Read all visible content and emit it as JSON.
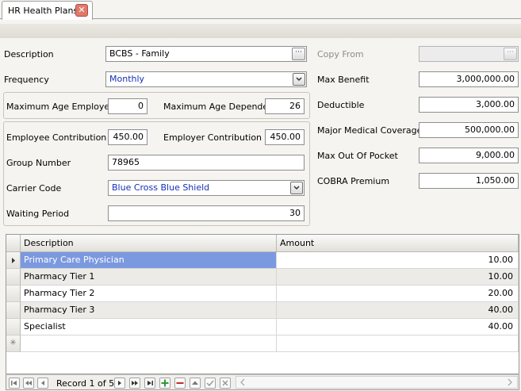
{
  "tab": {
    "label": "HR Health Plans",
    "close_glyph": "✕"
  },
  "form": {
    "description": {
      "label": "Description",
      "value": "BCBS - Family"
    },
    "frequency": {
      "label": "Frequency",
      "value": "Monthly"
    },
    "copy_from": {
      "label": "Copy From",
      "value": ""
    },
    "max_age_employee": {
      "label": "Maximum Age Employee",
      "value": "0"
    },
    "max_age_dependent": {
      "label": "Maximum Age Dependent",
      "value": "26"
    },
    "employee_contribution": {
      "label": "Employee Contribution",
      "value": "450.00"
    },
    "employer_contribution": {
      "label": "Employer Contribution",
      "value": "450.00"
    },
    "group_number": {
      "label": "Group Number",
      "value": "78965"
    },
    "carrier_code": {
      "label": "Carrier Code",
      "value": "Blue Cross Blue Shield"
    },
    "waiting_period": {
      "label": "Waiting Period",
      "value": "30"
    },
    "max_benefit": {
      "label": "Max Benefit",
      "value": "3,000,000.00"
    },
    "deductible": {
      "label": "Deductible",
      "value": "3,000.00"
    },
    "major_medical": {
      "label": "Major Medical Coverage",
      "value": "500,000.00"
    },
    "max_out_of_pocket": {
      "label": "Max Out Of Pocket",
      "value": "9,000.00"
    },
    "cobra_premium": {
      "label": "COBRA Premium",
      "value": "1,050.00"
    }
  },
  "grid": {
    "columns": [
      "Description",
      "Amount"
    ],
    "rows": [
      {
        "description": "Primary Care Physician",
        "amount": "10.00"
      },
      {
        "description": "Pharmacy Tier 1",
        "amount": "10.00"
      },
      {
        "description": "Pharmacy Tier 2",
        "amount": "20.00"
      },
      {
        "description": "Pharmacy Tier 3",
        "amount": "40.00"
      },
      {
        "description": "Specialist",
        "amount": "40.00"
      }
    ],
    "selected_row": 1,
    "new_row_glyph": "✳"
  },
  "navigator": {
    "record_text": "Record 1 of 5"
  },
  "colors": {
    "selection": "#7b99df",
    "link_blue": "#1430b8",
    "close_red": "#e07a6b"
  }
}
